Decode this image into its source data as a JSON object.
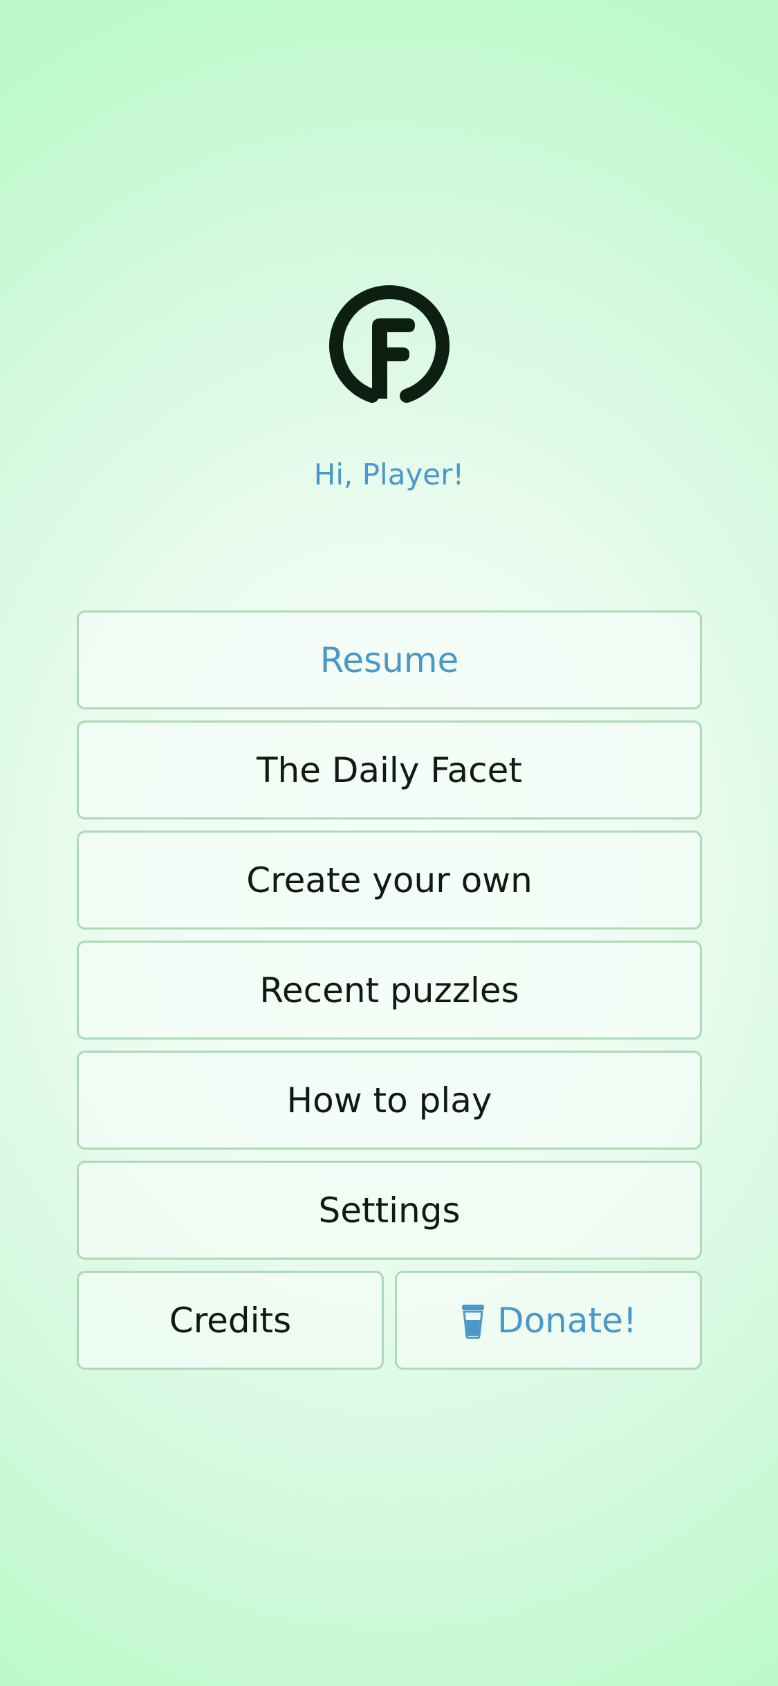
{
  "app": {
    "greeting": "Hi, Player!",
    "logo_icon": "facet-f-logo-icon",
    "colors": {
      "accent": "#4a98c7",
      "text": "#0e1a12",
      "border": "#aed8b6",
      "logo": "#0c1f12"
    }
  },
  "menu": {
    "resume": "Resume",
    "daily": "The Daily Facet",
    "create": "Create your own",
    "recent": "Recent puzzles",
    "howto": "How to play",
    "settings": "Settings",
    "credits": "Credits",
    "donate": "Donate!",
    "donate_icon": "coffee-cup-icon"
  }
}
